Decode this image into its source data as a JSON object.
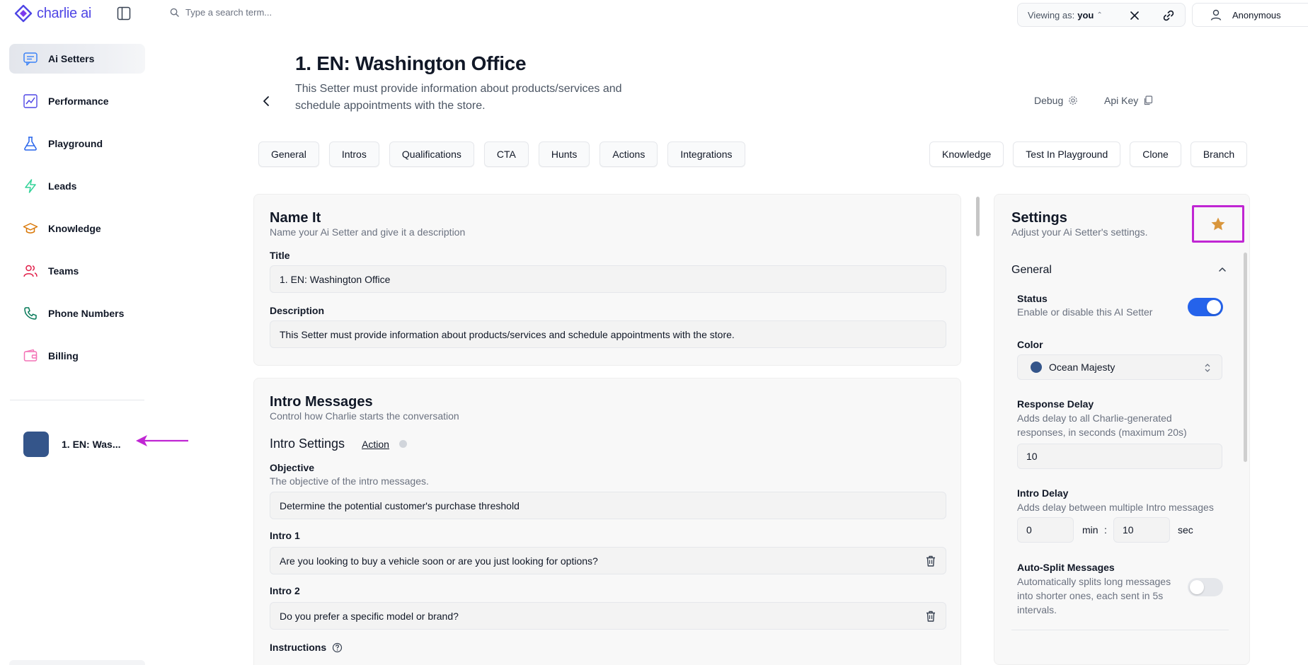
{
  "app": {
    "logo_text": "charlie ai",
    "search_placeholder": "Type a search term...",
    "viewing_prefix": "Viewing as:",
    "viewing_user": "you",
    "account_name": "Anonymous"
  },
  "sidebar": {
    "items": [
      {
        "label": "Ai Setters",
        "icon": "chat-bubble-icon",
        "active": true
      },
      {
        "label": "Performance",
        "icon": "chart-icon"
      },
      {
        "label": "Playground",
        "icon": "flask-icon"
      },
      {
        "label": "Leads",
        "icon": "lightning-icon"
      },
      {
        "label": "Knowledge",
        "icon": "graduation-cap-icon"
      },
      {
        "label": "Teams",
        "icon": "users-icon"
      },
      {
        "label": "Phone Numbers",
        "icon": "phone-icon"
      },
      {
        "label": "Billing",
        "icon": "wallet-icon"
      }
    ],
    "recent_item_label": "1. EN: Was...",
    "recent_item_color": "#34558a"
  },
  "header": {
    "title": "1. EN: Washington Office",
    "subtitle": "This Setter must provide information about products/services and schedule appointments with the store.",
    "debug_label": "Debug",
    "apikey_label": "Api Key"
  },
  "tabs": [
    "General",
    "Intros",
    "Qualifications",
    "CTA",
    "Hunts",
    "Actions",
    "Integrations"
  ],
  "action_buttons": [
    "Knowledge",
    "Test In Playground",
    "Clone",
    "Branch"
  ],
  "name_card": {
    "title": "Name It",
    "subtitle": "Name your Ai Setter and give it a description",
    "title_label": "Title",
    "title_value": "1. EN: Washington Office",
    "description_label": "Description",
    "description_value": "This Setter must provide information about products/services and schedule appointments with the store."
  },
  "intro_card": {
    "title": "Intro Messages",
    "subtitle": "Control how Charlie starts the conversation",
    "settings_title": "Intro Settings",
    "action_link": "Action",
    "objective_label": "Objective",
    "objective_help": "The objective of the intro messages.",
    "objective_value": "Determine the potential customer's purchase threshold",
    "intro1_label": "Intro 1",
    "intro1_value": "Are you looking to buy a vehicle soon or are you just looking for options?",
    "intro2_label": "Intro 2",
    "intro2_value": "Do you prefer a specific model or brand?",
    "instructions_label": "Instructions"
  },
  "settings": {
    "title": "Settings",
    "subtitle": "Adjust your Ai Setter's settings.",
    "section_general": "General",
    "status_label": "Status",
    "status_help": "Enable or disable this AI Setter",
    "status_on": true,
    "color_label": "Color",
    "color_value": "Ocean Majesty",
    "color_hex": "#34558a",
    "response_delay_label": "Response Delay",
    "response_delay_help": "Adds delay to all Charlie-generated responses, in seconds (maximum 20s)",
    "response_delay_value": "10",
    "intro_delay_label": "Intro Delay",
    "intro_delay_help": "Adds delay between multiple Intro messages",
    "intro_delay_min": "0",
    "intro_delay_min_unit": "min",
    "intro_delay_sep": ":",
    "intro_delay_sec": "10",
    "intro_delay_sec_unit": "sec",
    "autosplit_label": "Auto-Split Messages",
    "autosplit_help": "Automatically splits long messages into shorter ones, each sent in 5s intervals.",
    "autosplit_on": false
  },
  "colors": {
    "accent": "#2563eb",
    "brand": "#4f46e5",
    "highlight": "#c026d3",
    "star": "#d9963c"
  }
}
